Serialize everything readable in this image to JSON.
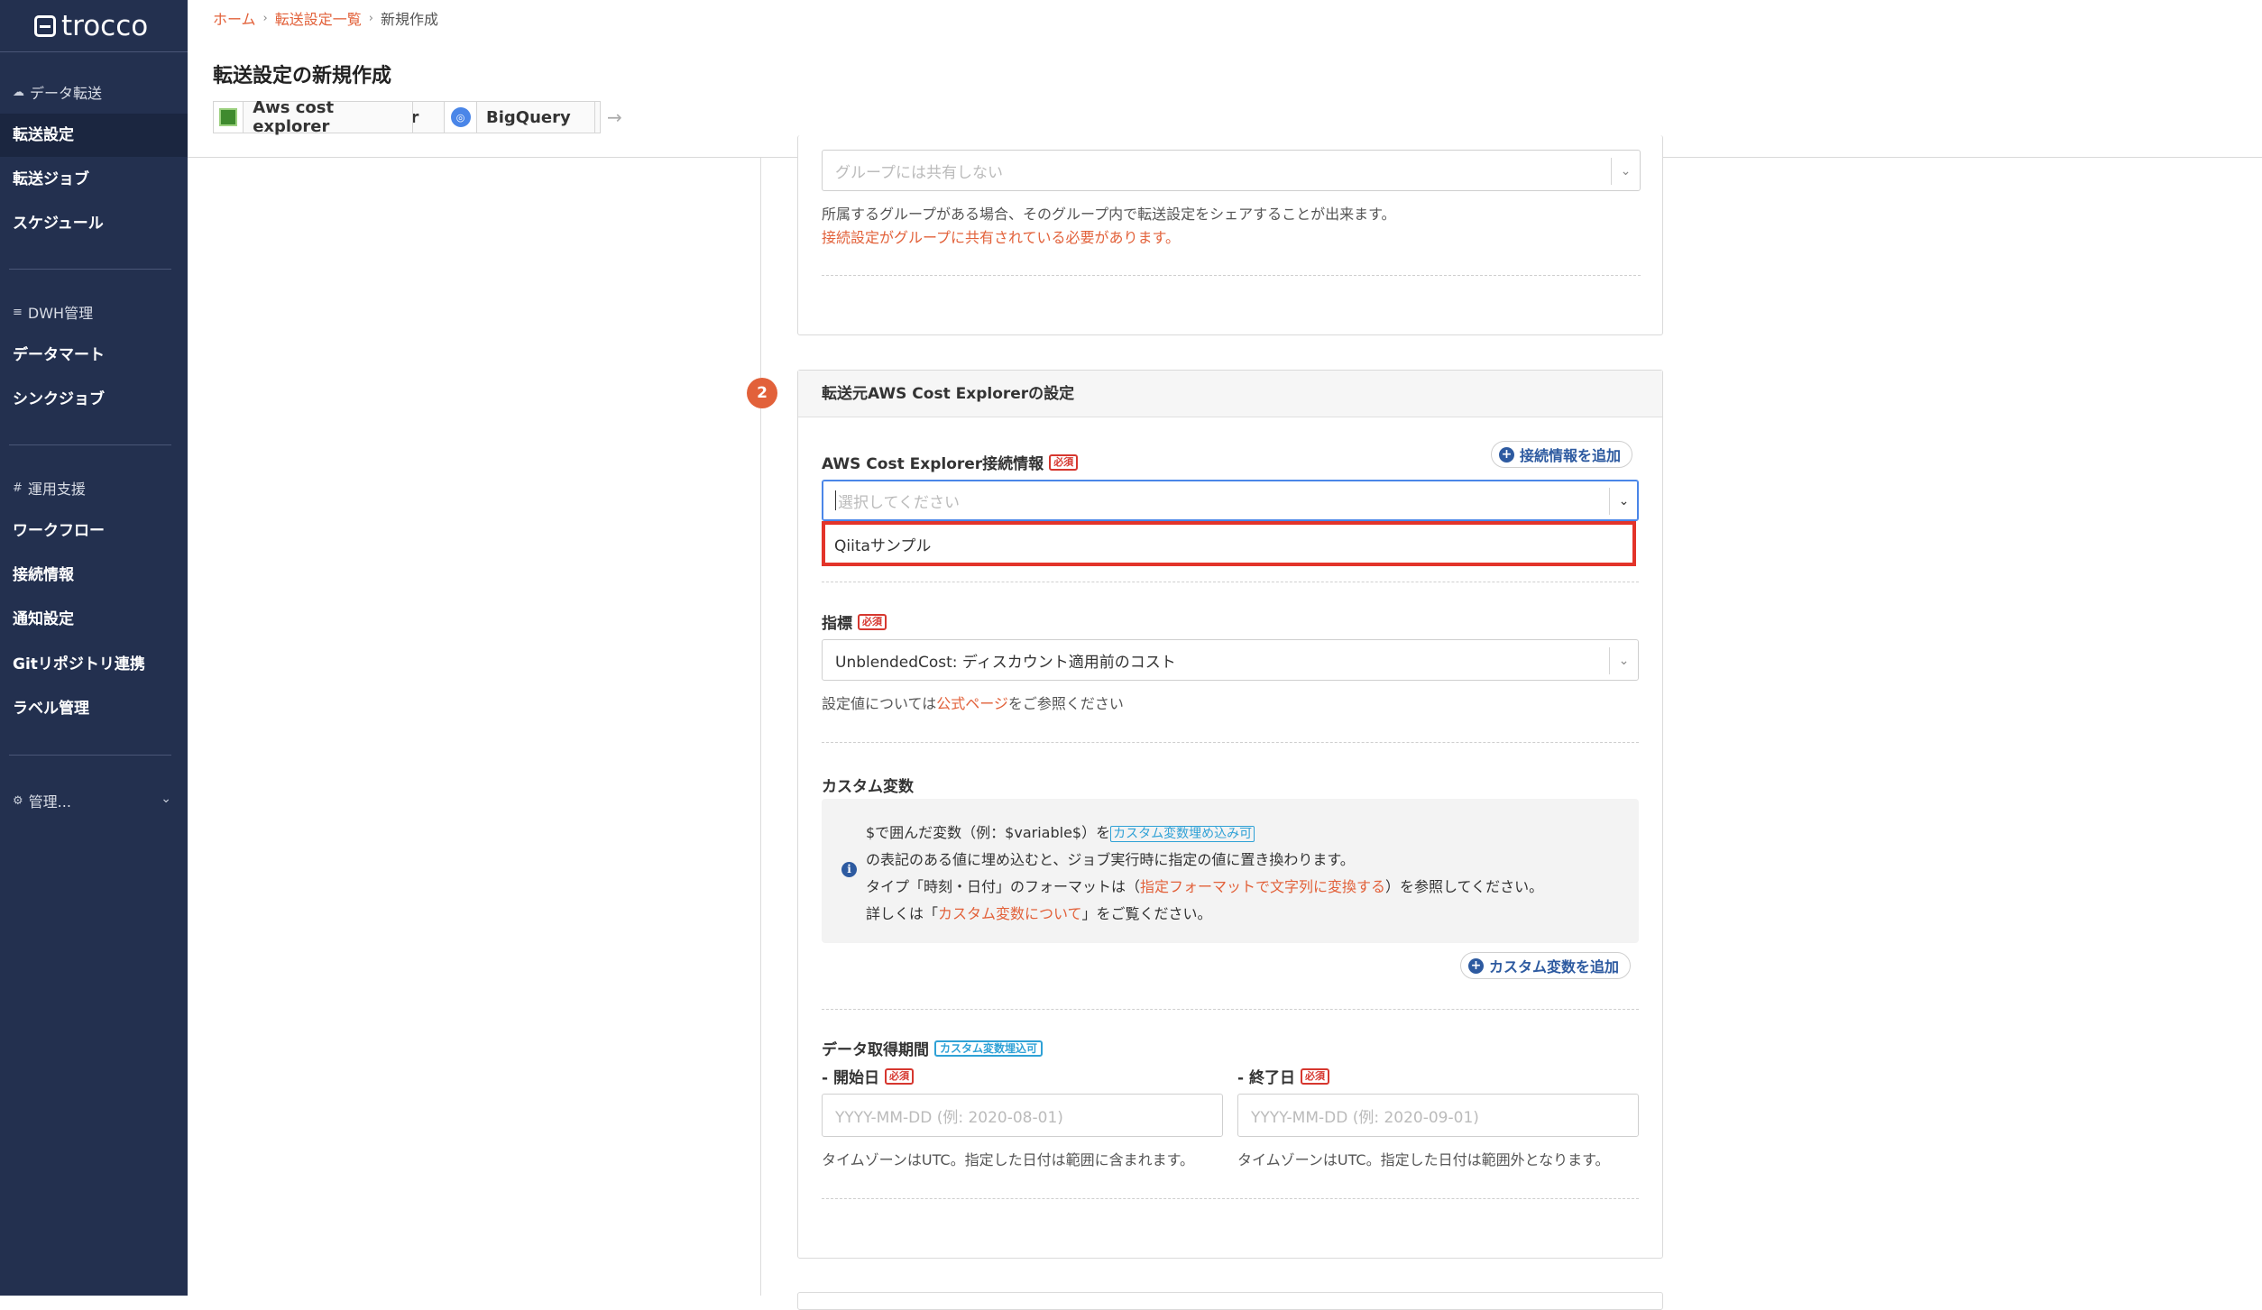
{
  "sidebar": {
    "logo": "trocco",
    "sections": [
      {
        "label": "データ転送",
        "icon": "cloud-icon"
      },
      {
        "label": "DWH管理",
        "icon": "list-icon"
      },
      {
        "label": "運用支援",
        "icon": "grid-icon"
      },
      {
        "label": "管理...",
        "icon": "gear-icon"
      }
    ],
    "items": [
      {
        "label": "転送設定"
      },
      {
        "label": "転送ジョブ"
      },
      {
        "label": "スケジュール"
      },
      {
        "label": "データマート"
      },
      {
        "label": "シンクジョブ"
      },
      {
        "label": "ワークフロー"
      },
      {
        "label": "接続情報"
      },
      {
        "label": "通知設定"
      },
      {
        "label": "Gitリポジトリ連携"
      },
      {
        "label": "ラベル管理"
      }
    ]
  },
  "header": {
    "breadcrumb": [
      "ホーム",
      "転送設定一覧",
      "新規作成"
    ],
    "title": "転送設定の新規作成",
    "source": "Aws cost explorer",
    "destination": "BigQuery"
  },
  "section1": {
    "group_placeholder": "グループには共有しない",
    "group_help": "所属するグループがある場合、そのグループ内で転送設定をシェアすることが出来ます。",
    "group_warning": "接続設定がグループに共有されている必要があります。"
  },
  "section2": {
    "step": "2",
    "title": "転送元AWS Cost Explorerの設定",
    "required_badge": "必須",
    "connection": {
      "label": "AWS Cost Explorer接続情報",
      "add_button": "接続情報を追加",
      "placeholder": "選択してください",
      "option": "Qiitaサンプル"
    },
    "metric": {
      "label": "指標",
      "value": "UnblendedCost: ディスカウント適用前のコスト",
      "help_prefix": "設定値については",
      "help_link": "公式ページ",
      "help_suffix": "をご参照ください"
    },
    "custom_vars": {
      "label": "カスタム変数",
      "line1_prefix": "$で囲んだ変数（例：$variable$）を",
      "line1_badge": "カスタム変数埋め込み可",
      "line2": "の表記のある値に埋め込むと、ジョブ実行時に指定の値に置き換わります。",
      "line3_prefix": "タイプ「時刻・日付」のフォーマットは（",
      "line3_link": "指定フォーマットで文字列に変換する",
      "line3_suffix": "）を参照してください。",
      "line4_prefix": "詳しくは「",
      "line4_link": "カスタム変数について",
      "line4_suffix": "」をご覧ください。",
      "add_button": "カスタム変数を追加"
    },
    "period": {
      "label": "データ取得期間",
      "badge": "カスタム変数埋込可",
      "start_label": "- 開始日",
      "end_label": "- 終了日",
      "start_placeholder": "YYYY-MM-DD (例: 2020-08-01)",
      "end_placeholder": "YYYY-MM-DD (例: 2020-09-01)",
      "start_help": "タイムゾーンはUTC。指定した日付は範囲に含まれます。",
      "end_help": "タイムゾーンはUTC。指定した日付は範囲外となります。"
    }
  }
}
